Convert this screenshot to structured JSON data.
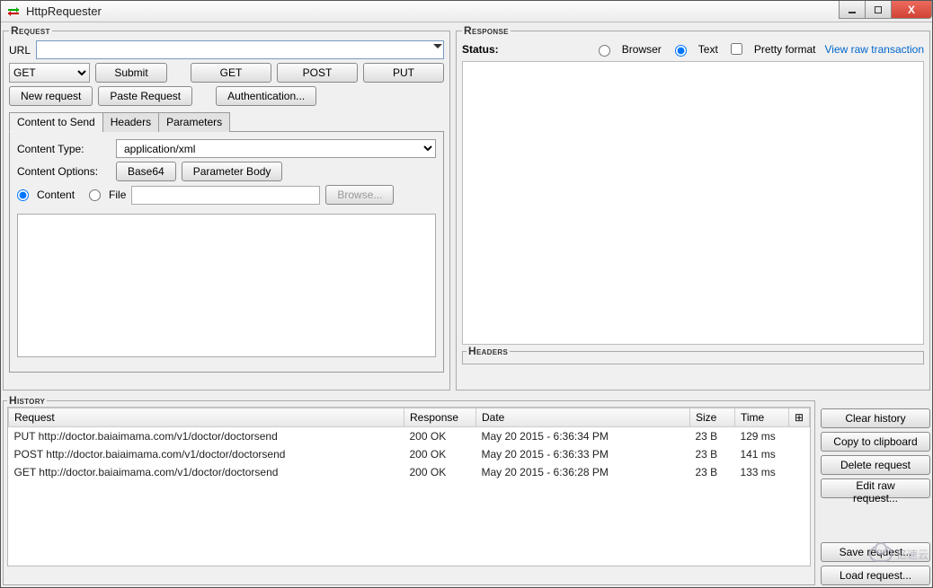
{
  "app_title": "HttpRequester",
  "request": {
    "legend": "Request",
    "url_label": "URL",
    "url_value": "",
    "method_selected": "GET",
    "submit_label": "Submit",
    "quick_get": "GET",
    "quick_post": "POST",
    "quick_put": "PUT",
    "new_request_label": "New request",
    "paste_request_label": "Paste Request",
    "authentication_label": "Authentication...",
    "tabs": {
      "content_to_send": "Content to Send",
      "headers": "Headers",
      "parameters": "Parameters"
    },
    "content_type_label": "Content Type:",
    "content_type_value": "application/xml",
    "content_options_label": "Content Options:",
    "base64_label": "Base64",
    "parameter_body_label": "Parameter Body",
    "content_radio_label": "Content",
    "file_radio_label": "File",
    "file_path_value": "",
    "browse_label": "Browse...",
    "body_text": ""
  },
  "response": {
    "legend": "Response",
    "status_label": "Status:",
    "mode_browser": "Browser",
    "mode_text": "Text",
    "pretty_label": "Pretty format",
    "view_raw_label": "View raw transaction",
    "headers_legend": "Headers"
  },
  "history": {
    "legend": "History",
    "columns": {
      "request": "Request",
      "response": "Response",
      "date": "Date",
      "size": "Size",
      "time": "Time",
      "picker": "⊞"
    },
    "rows": [
      {
        "req": "PUT http://doctor.baiaimama.com/v1/doctor/doctorsend",
        "resp": "200 OK",
        "date": "May 20 2015 - 6:36:34 PM",
        "size": "23 B",
        "time": "129 ms"
      },
      {
        "req": "POST http://doctor.baiaimama.com/v1/doctor/doctorsend",
        "resp": "200 OK",
        "date": "May 20 2015 - 6:36:33 PM",
        "size": "23 B",
        "time": "141 ms"
      },
      {
        "req": "GET http://doctor.baiaimama.com/v1/doctor/doctorsend",
        "resp": "200 OK",
        "date": "May 20 2015 - 6:36:28 PM",
        "size": "23 B",
        "time": "133 ms"
      }
    ],
    "buttons": {
      "clear": "Clear history",
      "copy": "Copy to clipboard",
      "delete": "Delete request",
      "edit_raw": "Edit raw request...",
      "save": "Save request...",
      "load": "Load request..."
    }
  },
  "watermark": "亿速云"
}
